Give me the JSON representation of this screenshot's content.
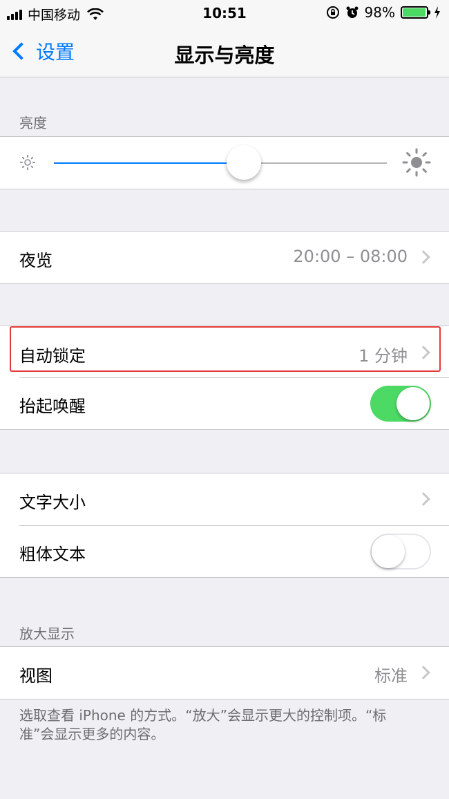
{
  "status_bar": {
    "carrier": "中国移动",
    "time": "10:51",
    "battery_percent": "98%",
    "battery_level": 0.98,
    "icons": [
      "signal-icon",
      "wifi-icon",
      "rotation-lock-icon",
      "alarm-icon",
      "battery-icon",
      "charging-icon"
    ]
  },
  "nav": {
    "back_label": "设置",
    "title": "显示与亮度"
  },
  "brightness": {
    "header": "亮度",
    "level": 0.57
  },
  "night_shift": {
    "label": "夜览",
    "value": "20:00 – 08:00"
  },
  "auto_lock": {
    "label": "自动锁定",
    "value": "1 分钟",
    "highlight_color": "#e53935"
  },
  "raise_to_wake": {
    "label": "抬起唤醒",
    "on": true
  },
  "text_size": {
    "label": "文字大小"
  },
  "bold_text": {
    "label": "粗体文本",
    "on": false
  },
  "zoom": {
    "header": "放大显示",
    "view_label": "视图",
    "view_value": "标准",
    "footer": "选取查看 iPhone 的方式。“放大”会显示更大的控制项。“标准”会显示更多的内容。"
  },
  "colors": {
    "accent": "#007aff",
    "toggle_on": "#4cd964",
    "background": "#efeff4"
  }
}
